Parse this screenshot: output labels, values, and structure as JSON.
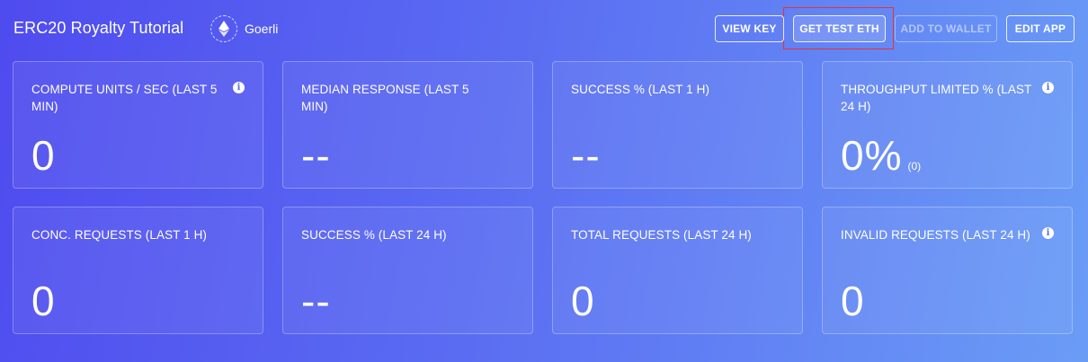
{
  "header": {
    "app_title": "ERC20 Royalty Tutorial",
    "network": {
      "label": "Goerli",
      "icon": "ethereum-icon"
    },
    "buttons": {
      "view_key": "VIEW KEY",
      "get_test_eth": "GET TEST ETH",
      "add_to_wallet": "ADD TO WALLET",
      "edit_app": "EDIT APP"
    }
  },
  "colors": {
    "background_start": "#4f4bef",
    "background_end": "#6a9cf6",
    "highlight": "#e3343a",
    "text": "#ffffff"
  },
  "metrics": [
    {
      "label": "COMPUTE UNITS / SEC (LAST 5 MIN)",
      "value": "0",
      "info": true
    },
    {
      "label": "MEDIAN RESPONSE (LAST 5 MIN)",
      "value": "--",
      "info": false
    },
    {
      "label": "SUCCESS % (LAST 1 H)",
      "value": "--",
      "info": false
    },
    {
      "label": "THROUGHPUT LIMITED % (LAST 24 H)",
      "value": "0%",
      "sub": "(0)",
      "info": true
    },
    {
      "label": "CONC. REQUESTS (LAST 1 H)",
      "value": "0",
      "info": false
    },
    {
      "label": "SUCCESS % (LAST 24 H)",
      "value": "--",
      "info": false
    },
    {
      "label": "TOTAL REQUESTS (LAST 24 H)",
      "value": "0",
      "info": false
    },
    {
      "label": "INVALID REQUESTS (LAST 24 H)",
      "value": "0",
      "info": true
    }
  ]
}
